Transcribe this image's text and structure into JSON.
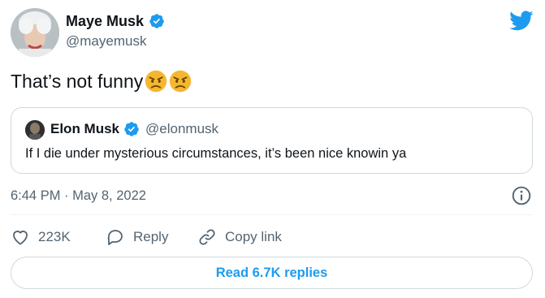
{
  "author": {
    "name": "Maye Musk",
    "handle": "@mayemusk",
    "verified": true
  },
  "tweet": {
    "text": "That’s not funny",
    "emoji": [
      "angry-face-emoji",
      "angry-face-emoji"
    ]
  },
  "quoted": {
    "name": "Elon Musk",
    "handle": "@elonmusk",
    "verified": true,
    "text": "If I die under mysterious circumstances, it’s been nice knowin ya"
  },
  "timestamp": "6:44 PM · May 8, 2022",
  "actions": {
    "like_count": "223K",
    "reply_label": "Reply",
    "copy_link_label": "Copy link"
  },
  "read_replies_label": "Read 6.7K replies",
  "colors": {
    "twitter_blue": "#1d9bf0",
    "verified_blue": "#1d9bf0",
    "muted_text": "#536471",
    "border": "#cfd9de",
    "emoji_face": "#f5b731"
  },
  "icons": {
    "logo": "twitter-bird-icon",
    "verified": "verified-badge-icon",
    "info": "info-icon",
    "like": "heart-icon",
    "reply": "speech-bubble-icon",
    "copy_link": "link-icon"
  }
}
